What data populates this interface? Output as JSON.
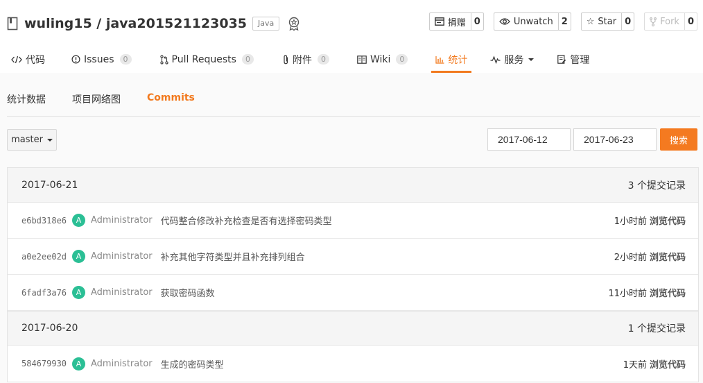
{
  "repo": {
    "title": "wuling15 / java201521123035",
    "language": "Java"
  },
  "actions": {
    "donate": {
      "label": "捐赠",
      "count": "0"
    },
    "watch": {
      "label": "Unwatch",
      "count": "2"
    },
    "star": {
      "label": "Star",
      "count": "0"
    },
    "fork": {
      "label": "Fork",
      "count": "0"
    }
  },
  "tabs": [
    {
      "label": "代码"
    },
    {
      "label": "Issues",
      "count": "0"
    },
    {
      "label": "Pull Requests",
      "count": "0"
    },
    {
      "label": "附件",
      "count": "0"
    },
    {
      "label": "Wiki",
      "count": "0"
    },
    {
      "label": "统计"
    },
    {
      "label": "服务"
    },
    {
      "label": "管理"
    }
  ],
  "subtabs": [
    "统计数据",
    "项目网络图",
    "Commits"
  ],
  "filters": {
    "branch": "master",
    "date_from": "2017-06-12",
    "date_to": "2017-06-23",
    "search_label": "搜索"
  },
  "browse_label": "浏览代码",
  "groups": [
    {
      "date": "2017-06-21",
      "count_text": "3 个提交记录",
      "commits": [
        {
          "sha": "e6bd318e6",
          "avatar": "A",
          "author": "Administrator",
          "message": "代码整合修改补充检查是否有选择密码类型",
          "time": "1小时前"
        },
        {
          "sha": "a0e2ee02d",
          "avatar": "A",
          "author": "Administrator",
          "message": "补充其他字符类型并且补充排列组合",
          "time": "2小时前"
        },
        {
          "sha": "6fadf3a76",
          "avatar": "A",
          "author": "Administrator",
          "message": "获取密码函数",
          "time": "11小时前"
        }
      ]
    },
    {
      "date": "2017-06-20",
      "count_text": "1 个提交记录",
      "commits": [
        {
          "sha": "584679930",
          "avatar": "A",
          "author": "Administrator",
          "message": "生成的密码类型",
          "time": "1天前"
        }
      ]
    }
  ],
  "colors": {
    "accent": "#f27a1f",
    "avatar": "#2bbf95"
  }
}
